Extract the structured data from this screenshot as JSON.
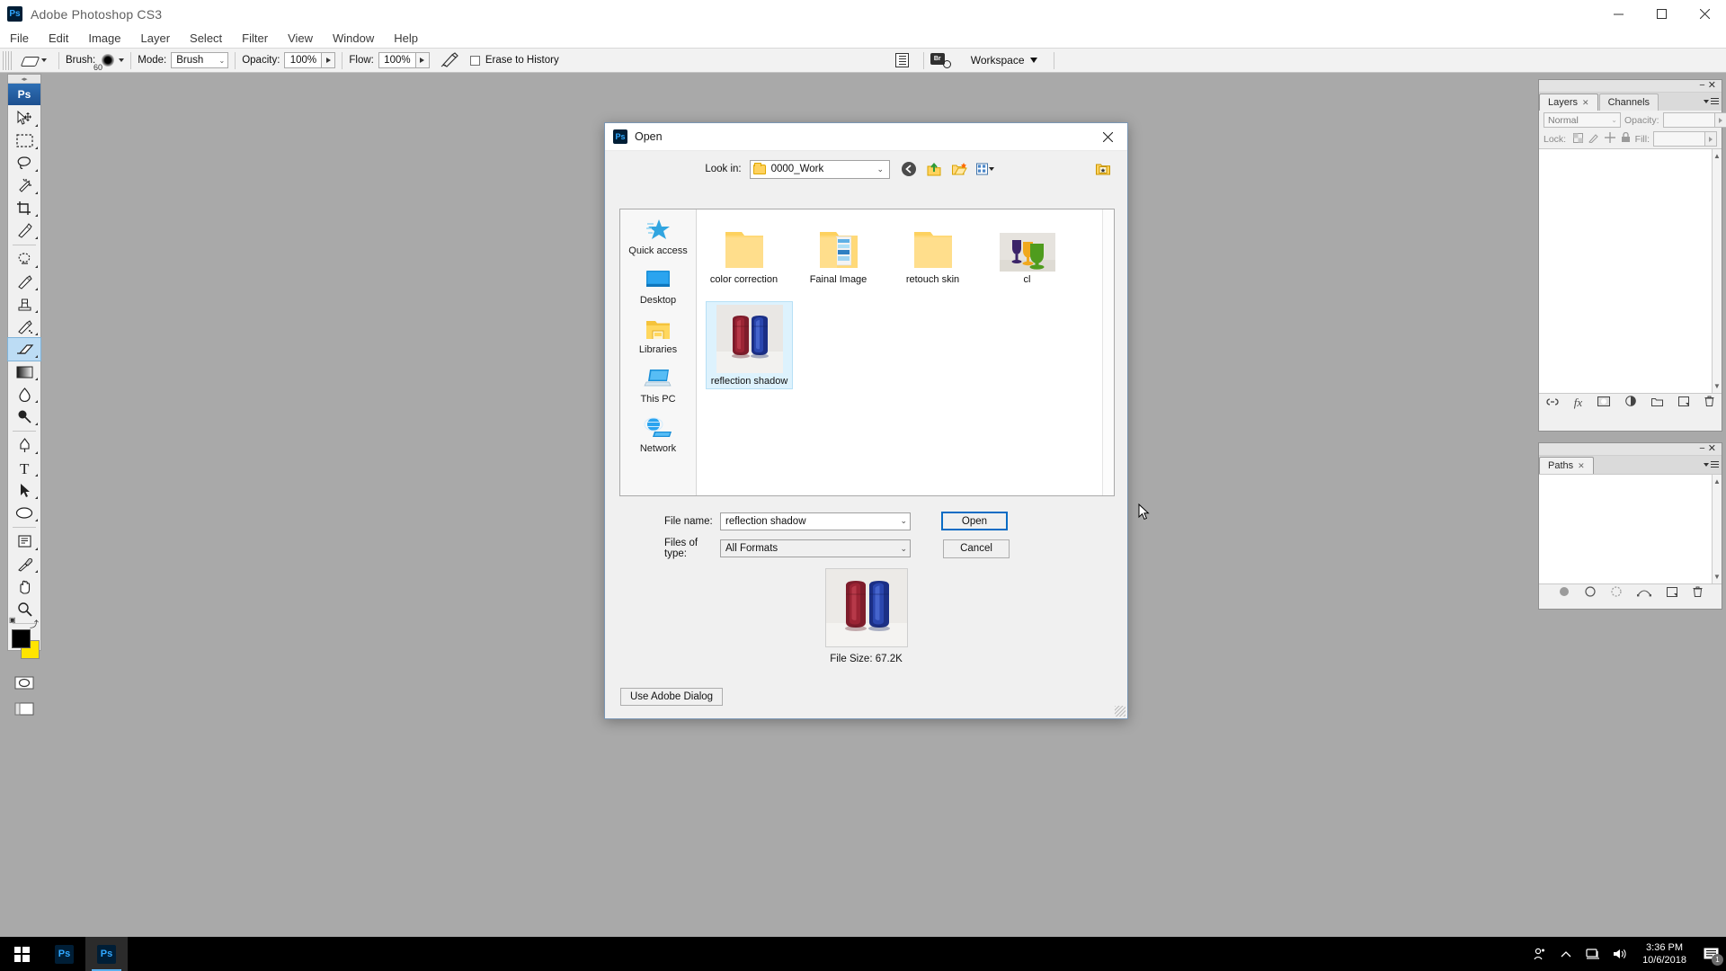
{
  "window": {
    "title": "Adobe Photoshop CS3",
    "logo_text": "Ps",
    "minimize": "—",
    "maximize": "▢",
    "close": "✕"
  },
  "menubar": {
    "items": [
      "File",
      "Edit",
      "Image",
      "Layer",
      "Select",
      "Filter",
      "View",
      "Window",
      "Help"
    ]
  },
  "options_bar": {
    "tool_icon": "eraser-icon",
    "brush_label": "Brush:",
    "brush_size": "60",
    "mode_label": "Mode:",
    "mode_value": "Brush",
    "opacity_label": "Opacity:",
    "opacity_value": "100%",
    "flow_label": "Flow:",
    "flow_value": "100%",
    "airbrush_icon": "airbrush-icon",
    "erase_to_history_label": "Erase to History",
    "erase_to_history_checked": false,
    "palettes_icon": "palettes-toggle-icon",
    "bridge_icon": "go-to-bridge-icon",
    "bridge_label": "Br",
    "workspace_label": "Workspace"
  },
  "toolbox": {
    "logo": "Ps",
    "tools": [
      {
        "name": "move-tool",
        "selected": false
      },
      {
        "name": "rectangular-marquee-tool",
        "selected": false
      },
      {
        "name": "lasso-tool",
        "selected": false
      },
      {
        "name": "magic-wand-tool",
        "selected": false
      },
      {
        "name": "crop-tool",
        "selected": false
      },
      {
        "name": "slice-tool",
        "selected": false
      },
      {
        "name": "healing-brush-tool",
        "selected": false
      },
      {
        "name": "brush-tool",
        "selected": false
      },
      {
        "name": "clone-stamp-tool",
        "selected": false
      },
      {
        "name": "history-brush-tool",
        "selected": false
      },
      {
        "name": "eraser-tool",
        "selected": true
      },
      {
        "name": "gradient-tool",
        "selected": false
      },
      {
        "name": "blur-tool",
        "selected": false
      },
      {
        "name": "dodge-tool",
        "selected": false
      },
      {
        "name": "pen-tool",
        "selected": false
      },
      {
        "name": "horizontal-type-tool",
        "selected": false
      },
      {
        "name": "path-selection-tool",
        "selected": false
      },
      {
        "name": "ellipse-shape-tool",
        "selected": false
      },
      {
        "name": "notes-tool",
        "selected": false
      },
      {
        "name": "eyedropper-tool",
        "selected": false
      },
      {
        "name": "hand-tool",
        "selected": false
      },
      {
        "name": "zoom-tool",
        "selected": false
      }
    ],
    "foreground_color": "#000000",
    "background_color": "#ffe400",
    "quick_mask_icon": "quick-mask-icon",
    "screen_mode_icon": "screen-mode-icon"
  },
  "layers_panel": {
    "tabs": [
      {
        "label": "Layers",
        "active": true
      },
      {
        "label": "Channels",
        "active": false
      }
    ],
    "blend_mode": "Normal",
    "opacity_label": "Opacity:",
    "opacity_value": "",
    "lock_label": "Lock:",
    "fill_label": "Fill:",
    "fill_value": "",
    "footer_icons": [
      "link-layers-icon",
      "layer-style-fx-icon",
      "layer-mask-icon",
      "adjustment-layer-icon",
      "new-group-icon",
      "new-layer-icon",
      "delete-layer-icon"
    ]
  },
  "paths_panel": {
    "tabs": [
      {
        "label": "Paths",
        "active": true
      }
    ],
    "footer_icons": [
      "fill-path-icon",
      "stroke-path-icon",
      "path-as-selection-icon",
      "selection-as-path-icon",
      "new-path-icon",
      "delete-path-icon"
    ]
  },
  "dialog": {
    "title": "Open",
    "logo_text": "Ps",
    "close_label": "✕",
    "look_in_label": "Look in:",
    "look_in_value": "0000_Work",
    "nav_icons": [
      "back-icon",
      "up-one-level-icon",
      "create-new-folder-icon",
      "views-icon",
      "new-folder-right-icon"
    ],
    "places": [
      {
        "label": "Quick access",
        "icon": "quick-access-star-icon"
      },
      {
        "label": "Desktop",
        "icon": "desktop-monitor-icon"
      },
      {
        "label": "Libraries",
        "icon": "libraries-folder-icon"
      },
      {
        "label": "This PC",
        "icon": "this-pc-laptop-icon"
      },
      {
        "label": "Network",
        "icon": "network-globe-icon"
      }
    ],
    "files": [
      {
        "name": "color correction",
        "type": "folder",
        "selected": false
      },
      {
        "name": "Fainal Image",
        "type": "folder-with-images",
        "selected": false
      },
      {
        "name": "retouch skin",
        "type": "folder",
        "selected": false
      },
      {
        "name": "cl",
        "type": "image",
        "selected": false
      },
      {
        "name": "reflection shadow",
        "type": "image",
        "selected": true
      }
    ],
    "file_name_label": "File name:",
    "file_name_value": "reflection shadow",
    "files_of_type_label": "Files of type:",
    "files_of_type_value": "All Formats",
    "open_button": "Open",
    "cancel_button": "Cancel",
    "preview_caption": "File Size: 67.2K",
    "use_adobe_dialog_button": "Use Adobe Dialog"
  },
  "taskbar": {
    "start_icon": "windows-start-icon",
    "apps": [
      {
        "name": "photoshop-pinned",
        "label": "Ps",
        "active": false
      },
      {
        "name": "photoshop-running",
        "label": "Ps",
        "active": true
      }
    ],
    "tray_icons": [
      "people-icon",
      "show-hidden-icons-chevron",
      "network-icon",
      "volume-icon"
    ],
    "time": "3:36 PM",
    "date": "10/6/2018",
    "notification_icon": "action-center-icon",
    "notification_count": "1"
  }
}
